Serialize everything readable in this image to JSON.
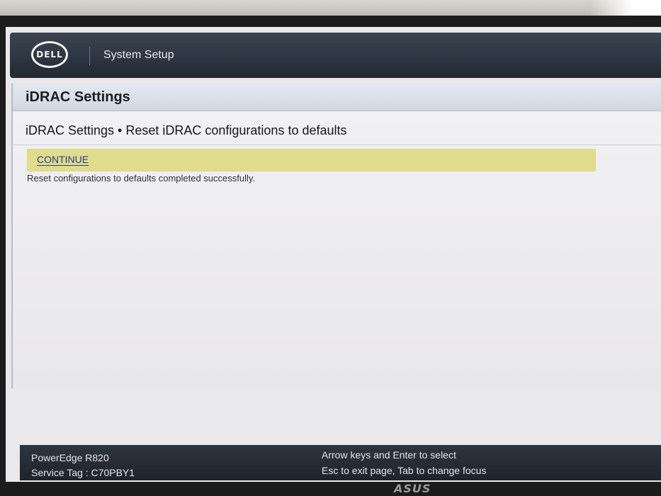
{
  "header": {
    "logo": "DELL",
    "title": "System Setup"
  },
  "section": {
    "title": "iDRAC Settings",
    "breadcrumb": "iDRAC Settings • Reset iDRAC configurations to defaults"
  },
  "actions": {
    "continue_label": "CONTINUE"
  },
  "status": {
    "message": "Reset configurations to defaults completed successfully."
  },
  "footer": {
    "model": "PowerEdge R820",
    "service_tag": "Service Tag : C70PBY1",
    "hint_select": "Arrow keys and Enter to select",
    "hint_exit": "Esc to exit page, Tab to change focus"
  },
  "monitor": {
    "brand": "ASUS"
  },
  "colors": {
    "header_bg": "#2a323c",
    "highlight_row": "#dfdc8c",
    "link": "#2a3d8a",
    "footer_bg": "#242b34"
  }
}
